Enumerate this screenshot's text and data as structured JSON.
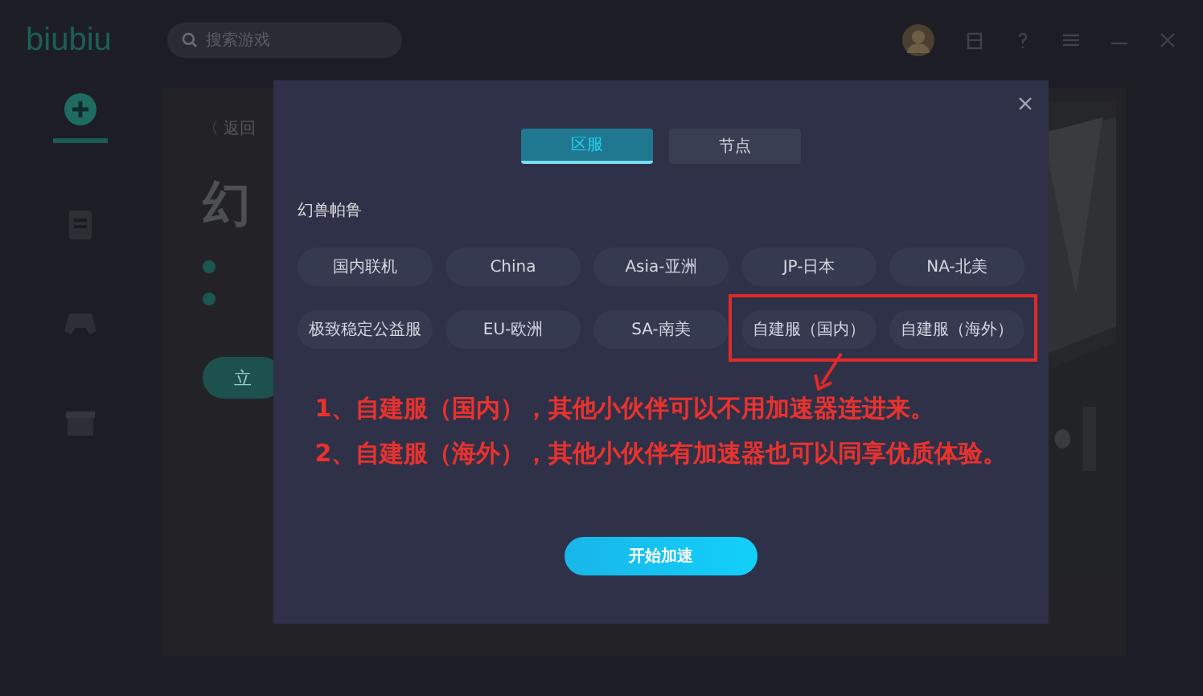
{
  "app": {
    "logo": "biubiu",
    "search": {
      "placeholder": "搜索游戏"
    }
  },
  "background_page": {
    "back_label": "〈 返回",
    "title": "幻",
    "action_label": "立"
  },
  "dialog": {
    "tabs": [
      {
        "label": "区服",
        "selected": true
      },
      {
        "label": "节点",
        "selected": false
      }
    ],
    "section_title": "幻兽帕鲁",
    "servers": [
      "国内联机",
      "China",
      "Asia-亚洲",
      "JP-日本",
      "NA-北美",
      "极致稳定公益服",
      "EU-欧洲",
      "SA-南美"
    ],
    "framed_servers": [
      "自建服（国内）",
      "自建服（海外）"
    ],
    "notes": [
      "1、自建服（国内），其他小伙伴可以不用加速器连进来。",
      "2、自建服（海外），其他小伙伴有加速器也可以同享优质体验。"
    ],
    "start_button": "开始加速"
  }
}
